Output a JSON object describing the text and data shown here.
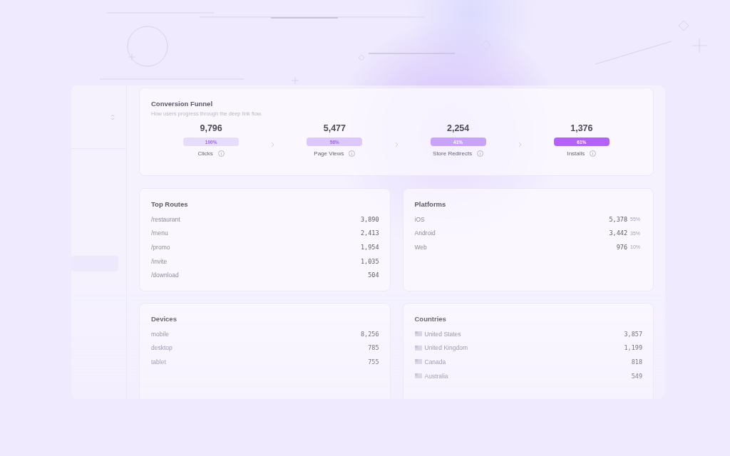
{
  "funnel": {
    "title": "Conversion Funnel",
    "subtitle": "How users progress through the deep link flow.",
    "steps": [
      {
        "value": "9,796",
        "percent": "100%",
        "label": "Clicks",
        "color": "#e6ddfd"
      },
      {
        "value": "5,477",
        "percent": "56%",
        "label": "Page Views",
        "color": "#dcc8fb"
      },
      {
        "value": "2,254",
        "percent": "41%",
        "label": "Store Redirects",
        "color": "#c8a4f8"
      },
      {
        "value": "1,376",
        "percent": "61%",
        "label": "Installs",
        "color": "#b362f5"
      }
    ]
  },
  "cards": [
    {
      "title": "Top Routes",
      "kind": "plain",
      "rows": [
        {
          "label": "/restaurant",
          "value": "3,890"
        },
        {
          "label": "/menu",
          "value": "2,413"
        },
        {
          "label": "/promo",
          "value": "1,954"
        },
        {
          "label": "/invite",
          "value": "1,035"
        },
        {
          "label": "/download",
          "value": "504"
        }
      ]
    },
    {
      "title": "Platforms",
      "kind": "share",
      "rows": [
        {
          "label": "iOS",
          "value": "5,378",
          "share": "55%"
        },
        {
          "label": "Android",
          "value": "3,442",
          "share": "35%"
        },
        {
          "label": "Web",
          "value": "976",
          "share": "10%"
        }
      ]
    },
    {
      "title": "Devices",
      "kind": "plain",
      "rows": [
        {
          "label": "mobile",
          "value": "8,256"
        },
        {
          "label": "desktop",
          "value": "785"
        },
        {
          "label": "tablet",
          "value": "755"
        }
      ]
    },
    {
      "title": "Countries",
      "kind": "flag",
      "rows": [
        {
          "label": "United States",
          "value": "3,857"
        },
        {
          "label": "United Kingdom",
          "value": "1,199"
        },
        {
          "label": "Canada",
          "value": "818"
        },
        {
          "label": "Australia",
          "value": "549"
        }
      ]
    }
  ]
}
